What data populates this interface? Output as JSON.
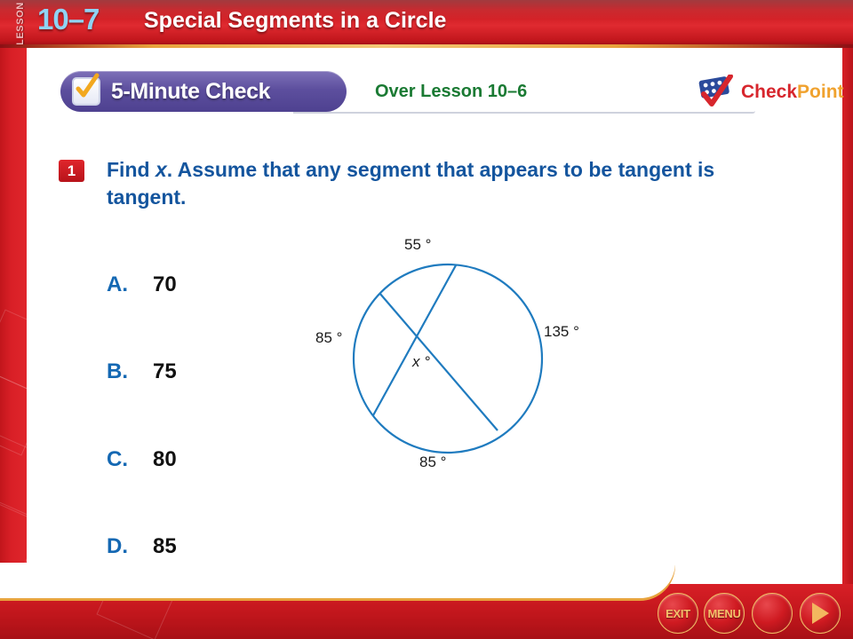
{
  "header": {
    "lesson_tag": "LESSON",
    "lesson_number": "10–7",
    "title": "Special Segments in a Circle"
  },
  "banner": {
    "check_label": "5-Minute Check",
    "check_icon": "checkbox-check-icon",
    "over_lesson": "Over Lesson 10–6"
  },
  "checkpoint_logo": {
    "icon": "checkpoint-grid-icon",
    "word_one": "Check",
    "word_two": "Point",
    "color_check": "#d7262d",
    "color_point": "#f0a22e"
  },
  "question": {
    "number": "1",
    "text_part_one": "Find ",
    "text_italic": "x",
    "text_part_two": ". Assume that any segment that appears to be tangent is tangent.",
    "color": "#14559e"
  },
  "choices": [
    {
      "letter": "A.",
      "value": "70"
    },
    {
      "letter": "B.",
      "value": "75"
    },
    {
      "letter": "C.",
      "value": "80"
    },
    {
      "letter": "D.",
      "value": "85"
    }
  ],
  "figure": {
    "name": "circle-with-intersecting-chords",
    "stroke_color": "#1f7bbf",
    "labels": {
      "top_arc": "55 °",
      "right_arc": "135 °",
      "left_arc": "85 °",
      "bottom_arc": "85 °",
      "angle": "x °"
    }
  },
  "nav": {
    "exit_label": "EXIT",
    "menu_label": "MENU",
    "back_icon": "triangle-left-icon",
    "next_icon": "triangle-right-icon"
  }
}
